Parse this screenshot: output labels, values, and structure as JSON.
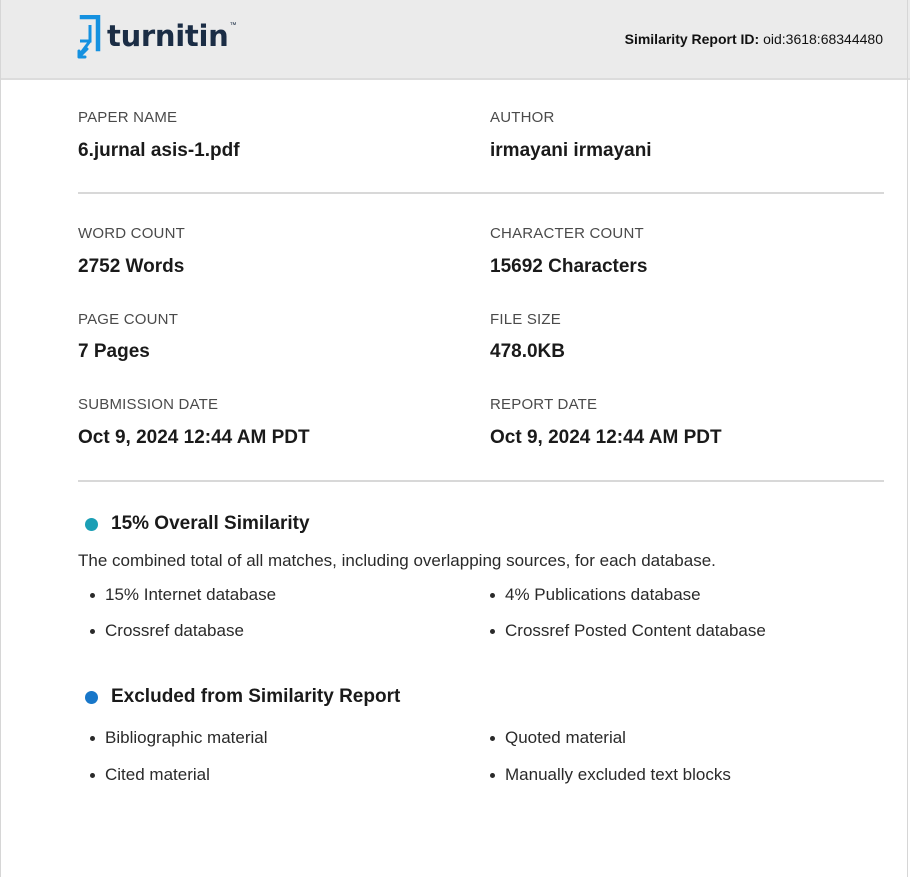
{
  "header": {
    "logo_text": "turnitin",
    "logo_tm": "™",
    "report_id_label": "Similarity Report ID:",
    "report_id_value": "oid:3618:68344480"
  },
  "details": {
    "paper_name_label": "PAPER NAME",
    "paper_name": "6.jurnal asis-1.pdf",
    "author_label": "AUTHOR",
    "author": "irmayani irmayani",
    "word_count_label": "WORD COUNT",
    "word_count": "2752 Words",
    "character_count_label": "CHARACTER COUNT",
    "character_count": "15692 Characters",
    "page_count_label": "PAGE COUNT",
    "page_count": "7 Pages",
    "file_size_label": "FILE SIZE",
    "file_size": "478.0KB",
    "submission_date_label": "SUBMISSION DATE",
    "submission_date": "Oct 9, 2024 12:44 AM PDT",
    "report_date_label": "REPORT DATE",
    "report_date": "Oct 9, 2024 12:44 AM PDT"
  },
  "similarity": {
    "title": "15% Overall Similarity",
    "dot_color": "#1b9fb5",
    "description": "The combined total of all matches, including overlapping sources, for each database.",
    "items": [
      "15% Internet database",
      "4% Publications database",
      "Crossref database",
      "Crossref Posted Content database"
    ]
  },
  "excluded": {
    "title": "Excluded from Similarity Report",
    "dot_color": "#1877c9",
    "items": [
      "Bibliographic material",
      "Quoted material",
      "Cited material",
      "Manually excluded text blocks"
    ]
  },
  "colors": {
    "brand_blue": "#1591e0",
    "brand_navy": "#1b2d45",
    "header_bg": "#ebebeb"
  }
}
